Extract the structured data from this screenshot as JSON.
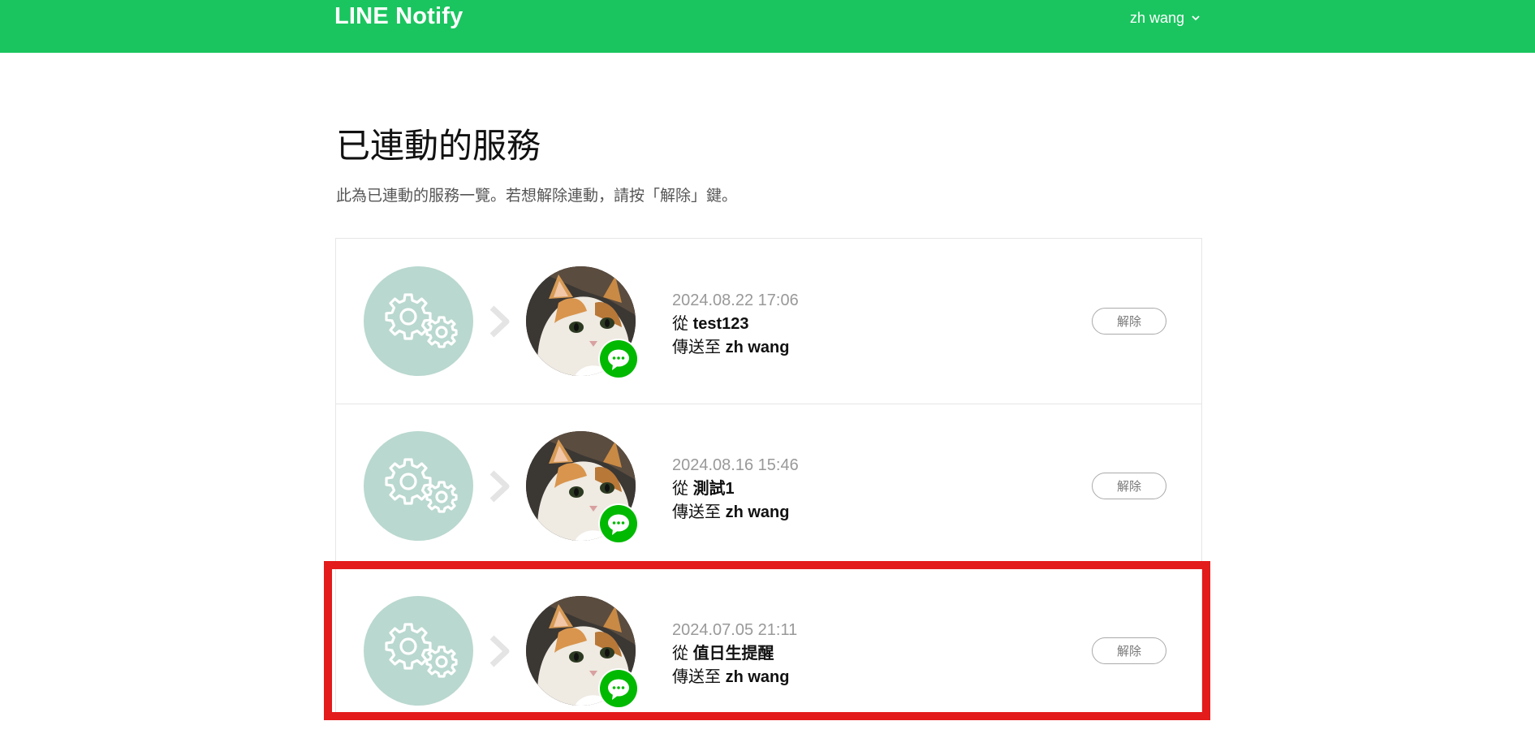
{
  "colors": {
    "brand": "#1ac55f",
    "highlight": "#e31b1b",
    "service_circle": "#b9d8cf",
    "line_badge": "#00b900"
  },
  "header": {
    "logo": "LINE Notify",
    "user_name": "zh wang",
    "user_menu_icon": "chevron-down-icon"
  },
  "page": {
    "title": "已連動的服務",
    "description": "此為已連動的服務一覽。若想解除連動，請按「解除」鍵。"
  },
  "services": [
    {
      "date": "2024.08.22 17:06",
      "from_prefix": "從",
      "from_name": "test123",
      "to_prefix": "傳送至",
      "to_name": "zh wang",
      "unlink_label": "解除"
    },
    {
      "date": "2024.08.16 15:46",
      "from_prefix": "從",
      "from_name": "測試1",
      "to_prefix": "傳送至",
      "to_name": "zh wang",
      "unlink_label": "解除"
    },
    {
      "date": "2024.07.05 21:11",
      "from_prefix": "從",
      "from_name": "值日生提醒",
      "to_prefix": "傳送至",
      "to_name": "zh wang",
      "unlink_label": "解除"
    }
  ],
  "icons": {
    "service": "gears-icon",
    "arrow": "chevron-right-icon",
    "avatar": "cat-avatar",
    "badge": "line-chat-icon"
  }
}
